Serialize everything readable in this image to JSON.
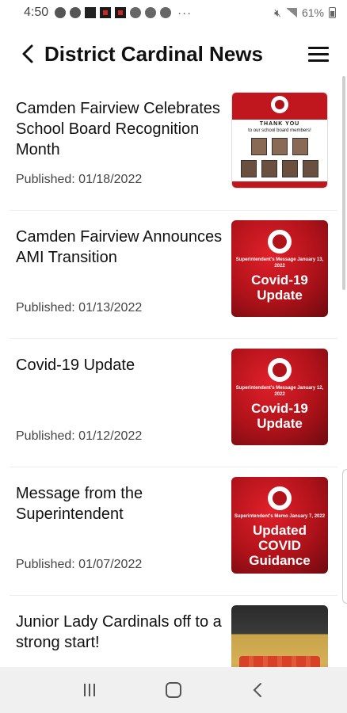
{
  "status_bar": {
    "time": "4:50",
    "dots": "···",
    "battery_percent": "61%"
  },
  "header": {
    "title": "District Cardinal News"
  },
  "articles": [
    {
      "title": "Camden Fairview Celebrates School Board Recognition Month",
      "date": "Published: 01/18/2022",
      "thumb": {
        "kind": "thanks",
        "line1": "THANK YOU",
        "line2": "to our school board members!"
      }
    },
    {
      "title": "Camden Fairview Announces AMI Transition",
      "date": "Published: 01/13/2022",
      "thumb": {
        "kind": "red",
        "small": "Superintendent's Message January 13, 2022",
        "big": "Covid-19 Update"
      }
    },
    {
      "title": "Covid-19 Update",
      "date": "Published: 01/12/2022",
      "thumb": {
        "kind": "red",
        "small": "Superintendent's Message January 12, 2022",
        "big": "Covid-19 Update"
      }
    },
    {
      "title": "Message from the Superintendent",
      "date": "Published: 01/07/2022",
      "thumb": {
        "kind": "red",
        "small": "Superintendent's Memo January 7, 2022",
        "big": "Updated COVID Guidance"
      }
    },
    {
      "title": "Junior Lady Cardinals off to a strong start!",
      "date": "",
      "thumb": {
        "kind": "photo"
      }
    }
  ],
  "colors": {
    "accent_red": "#c0171f",
    "text": "#111111",
    "nav_bg": "#f0f0f0"
  }
}
